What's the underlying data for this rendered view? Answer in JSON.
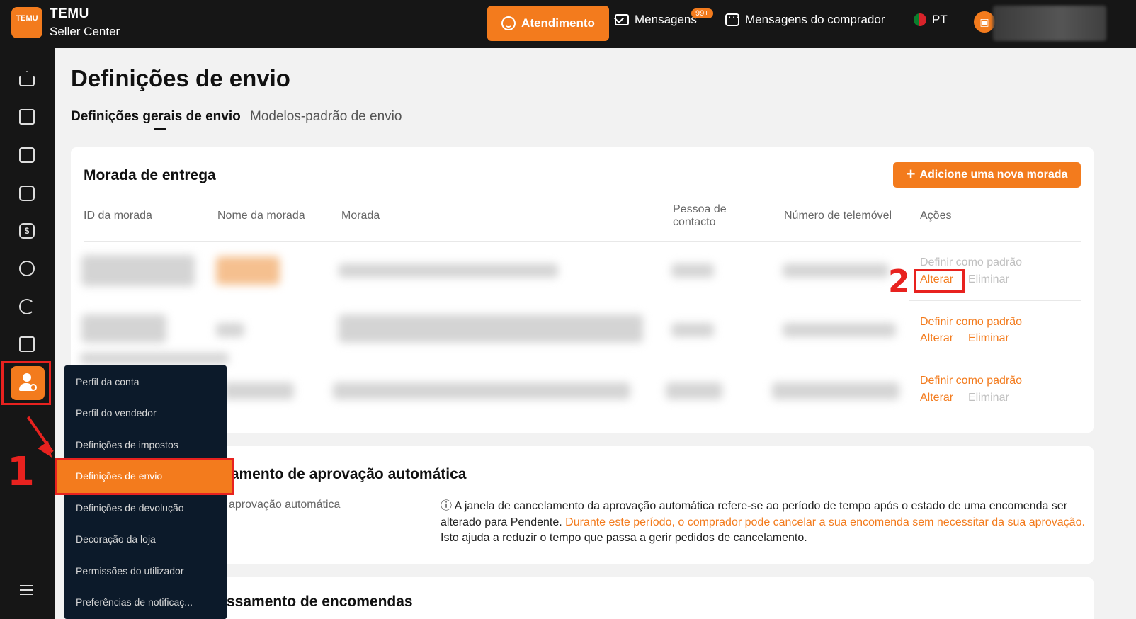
{
  "topbar": {
    "logo_text": "TEMU",
    "brand_line1": "TEMU",
    "brand_line2": "Seller Center",
    "atendimento": "Atendimento",
    "mensagens": "Mensagens",
    "mensagens_badge": "99+",
    "mensagens_comprador": "Mensagens do comprador",
    "language": "PT",
    "accent_color": "#f37b1d"
  },
  "sidebar": {
    "icons": [
      "home-icon",
      "bag-icon",
      "ticket-icon",
      "note-icon",
      "dollar-icon",
      "chart-icon",
      "pie-icon",
      "box-icon",
      "account-settings-icon",
      "menu-icon"
    ]
  },
  "submenu": {
    "items": [
      "Perfil da conta",
      "Perfil do vendedor",
      "Definições de impostos",
      "Definições de envio",
      "Definições de devolução",
      "Decoração da loja",
      "Permissões do utilizador",
      "Preferências de notificaç..."
    ],
    "active_index": 3
  },
  "page": {
    "title": "Definições de envio",
    "tabs": [
      "Definições gerais de envio",
      "Modelos-padrão de envio"
    ]
  },
  "address_section": {
    "title": "Morada de entrega",
    "add_button": "Adicione uma nova morada",
    "columns": [
      "ID da morada",
      "Nome da morada",
      "Morada",
      "Pessoa de contacto",
      "Número de telemóvel",
      "Ações"
    ],
    "rows": [
      {
        "set_default": "Definir como padrão",
        "edit": "Alterar",
        "delete": "Eliminar",
        "set_default_enabled": false,
        "delete_enabled": false
      },
      {
        "set_default": "Definir como padrão",
        "edit": "Alterar",
        "delete": "Eliminar",
        "set_default_enabled": true,
        "delete_enabled": true
      },
      {
        "set_default": "Definir como padrão",
        "edit": "Alterar",
        "delete": "Eliminar",
        "set_default_enabled": true,
        "delete_enabled": false
      }
    ]
  },
  "cancel_section": {
    "title_visible": "lamento de aprovação automática",
    "label_visible": "aprovação automática",
    "info_icon": "ⓘ",
    "info_text_1": "A janela de cancelamento da aprovação automática refere-se ao período de tempo após o estado de uma encomenda ser alterado para Pendente. ",
    "info_text_highlight": "Durante este período, o comprador pode cancelar a sua encomenda sem necessitar da sua aprovação.",
    "info_text_2": " Isto ajuda a reduzir o tempo que passa a gerir pedidos de cancelamento."
  },
  "third_section": {
    "title_visible": "ssamento de encomendas"
  },
  "annotations": {
    "step1": "1",
    "step2": "2",
    "color": "#e8221f"
  }
}
